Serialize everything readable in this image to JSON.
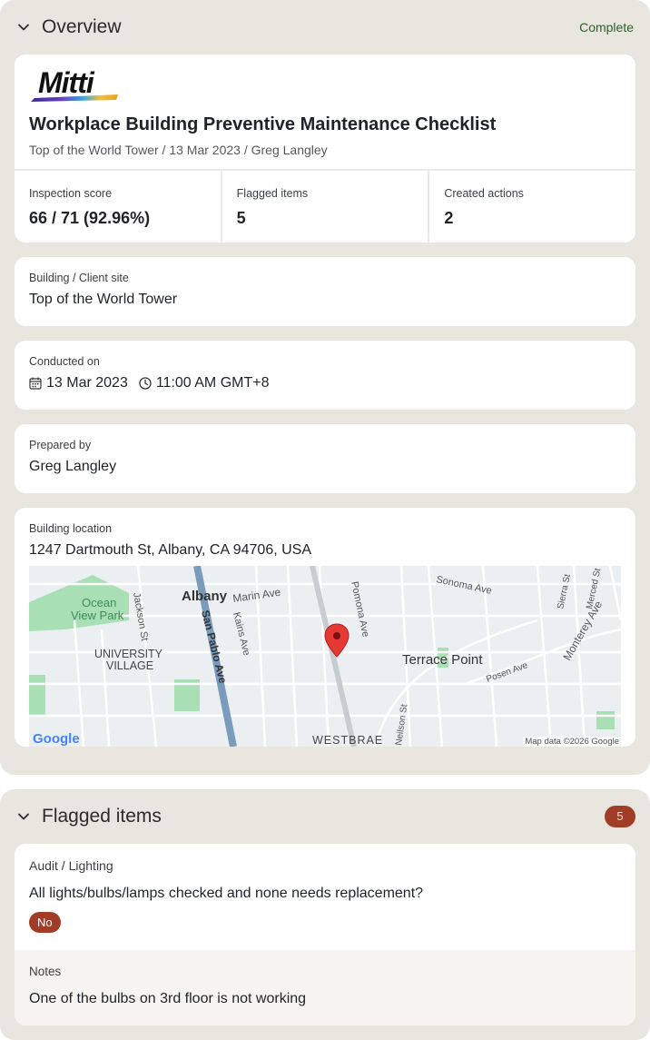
{
  "overview": {
    "title": "Overview",
    "status": "Complete",
    "report": {
      "logo_text": "Mitti",
      "title": "Workplace Building Preventive Maintenance Checklist",
      "subtitle": "Top of the World Tower / 13 Mar 2023 / Greg Langley",
      "stats": [
        {
          "label": "Inspection score",
          "value": "66 / 71 (92.96%)"
        },
        {
          "label": "Flagged items",
          "value": "5"
        },
        {
          "label": "Created actions",
          "value": "2"
        }
      ]
    },
    "site": {
      "label": "Building / Client site",
      "value": "Top of the World Tower"
    },
    "conducted": {
      "label": "Conducted on",
      "date": "13 Mar 2023",
      "time": "11:00 AM GMT+8"
    },
    "prepared": {
      "label": "Prepared by",
      "value": "Greg Langley"
    },
    "location": {
      "label": "Building location",
      "address": "1247 Dartmouth St, Albany, CA 94706, USA",
      "map": {
        "labels": {
          "ocean_view_park": "Ocean View Park",
          "ocean": "Ocean",
          "view_park": "View Park",
          "albany": "Albany",
          "marin_ave": "Marin Ave",
          "jackson_st": "Jackson St",
          "san_pablo_ave": "San Pablo Ave",
          "kains_ave": "Kains Ave",
          "pomona_ave": "Pomona Ave",
          "sonoma_ave": "Sonoma Ave",
          "sierra_st": "Sierra St",
          "merced_st": "Merced St",
          "monterey_ave": "Monterey Ave",
          "university": "UNIVERSITY",
          "village": "VILLAGE",
          "terrace_point": "Terrace Point",
          "posen_ave": "Posen Ave",
          "neilson_st": "Neilson St",
          "westbrae": "WESTBRAE"
        },
        "google": "Google",
        "attribution": "Map data ©2026 Google",
        "colors": {
          "pin": "#e53935",
          "park": "#a8dfb5",
          "freeway": "#7b9bbd",
          "road": "#ffffff"
        }
      }
    }
  },
  "flagged": {
    "title": "Flagged items",
    "count": "5",
    "items": [
      {
        "path": "Audit / Lighting",
        "question": "All lights/bulbs/lamps checked and none needs replacement?",
        "answer": "No",
        "notes_label": "Notes",
        "notes": "One of the bulbs on 3rd floor is not working"
      }
    ]
  }
}
